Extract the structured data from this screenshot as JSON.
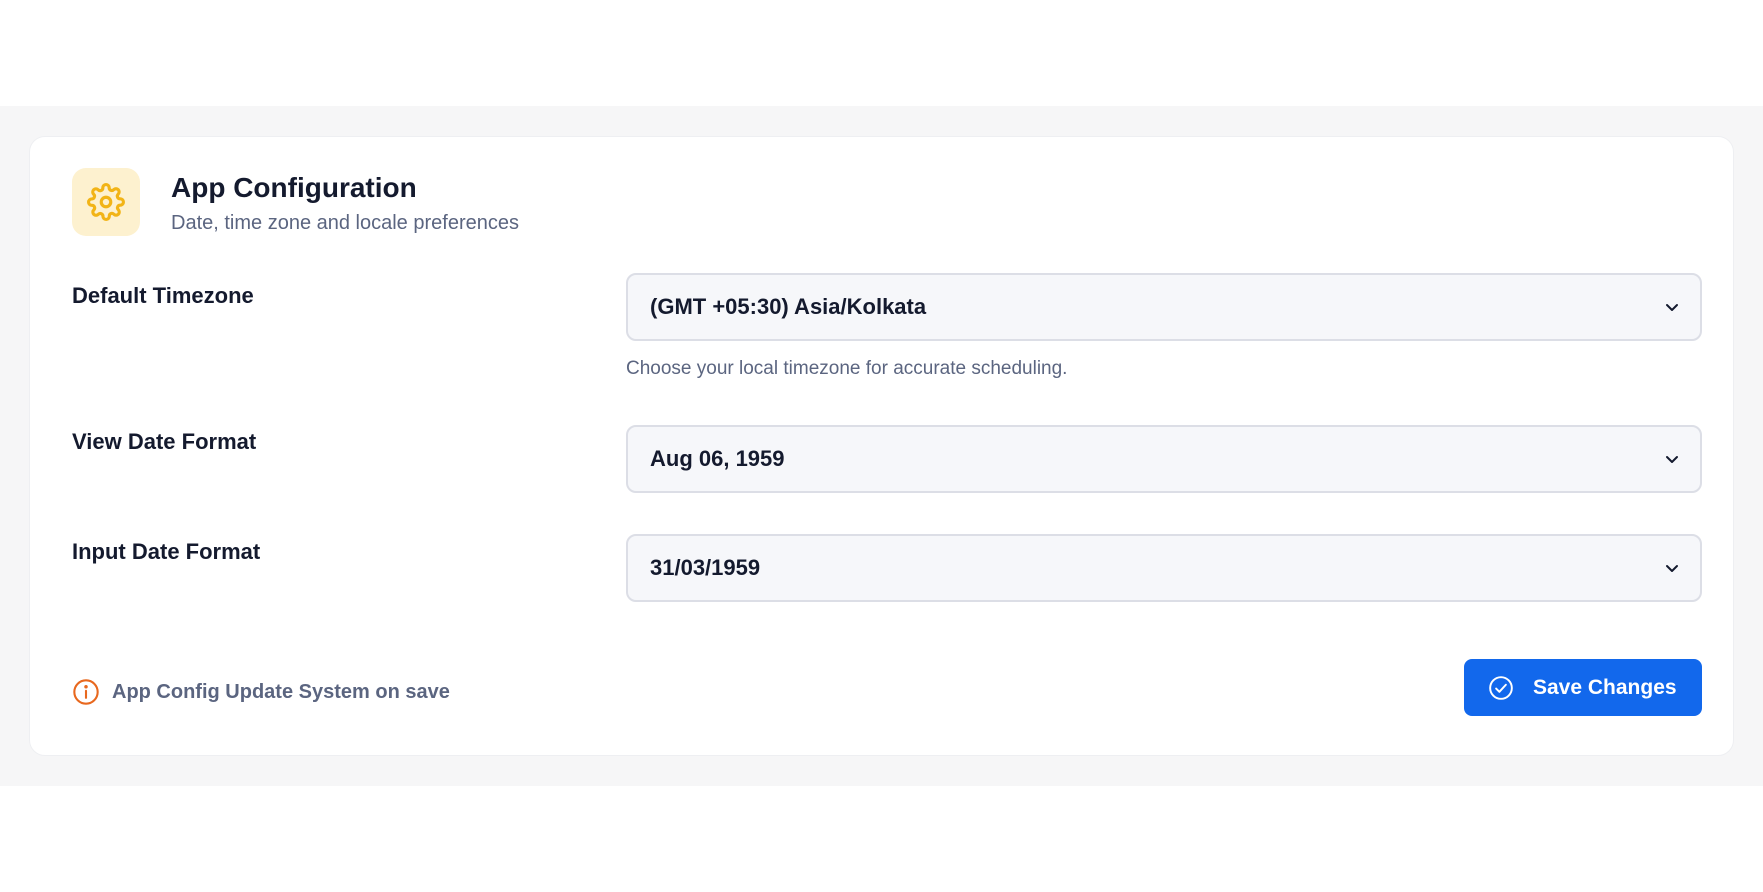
{
  "header": {
    "title": "App Configuration",
    "subtitle": "Date, time zone and locale preferences",
    "icon": "gear-icon",
    "icon_color": "#f2b416",
    "icon_bg": "#fdf1cf"
  },
  "fields": {
    "timezone": {
      "label": "Default Timezone",
      "value": "(GMT +05:30) Asia/Kolkata",
      "hint": "Choose your local timezone for accurate scheduling."
    },
    "view_date": {
      "label": "View Date Format",
      "value": "Aug 06, 1959"
    },
    "input_date": {
      "label": "Input Date Format",
      "value": "31/03/1959"
    }
  },
  "footer": {
    "note": "App Config Update System on save",
    "note_icon": "info-icon",
    "note_icon_color": "#e8681e",
    "save_label": "Save Changes",
    "save_icon": "check-circle-icon",
    "accent": "#1268ec"
  }
}
